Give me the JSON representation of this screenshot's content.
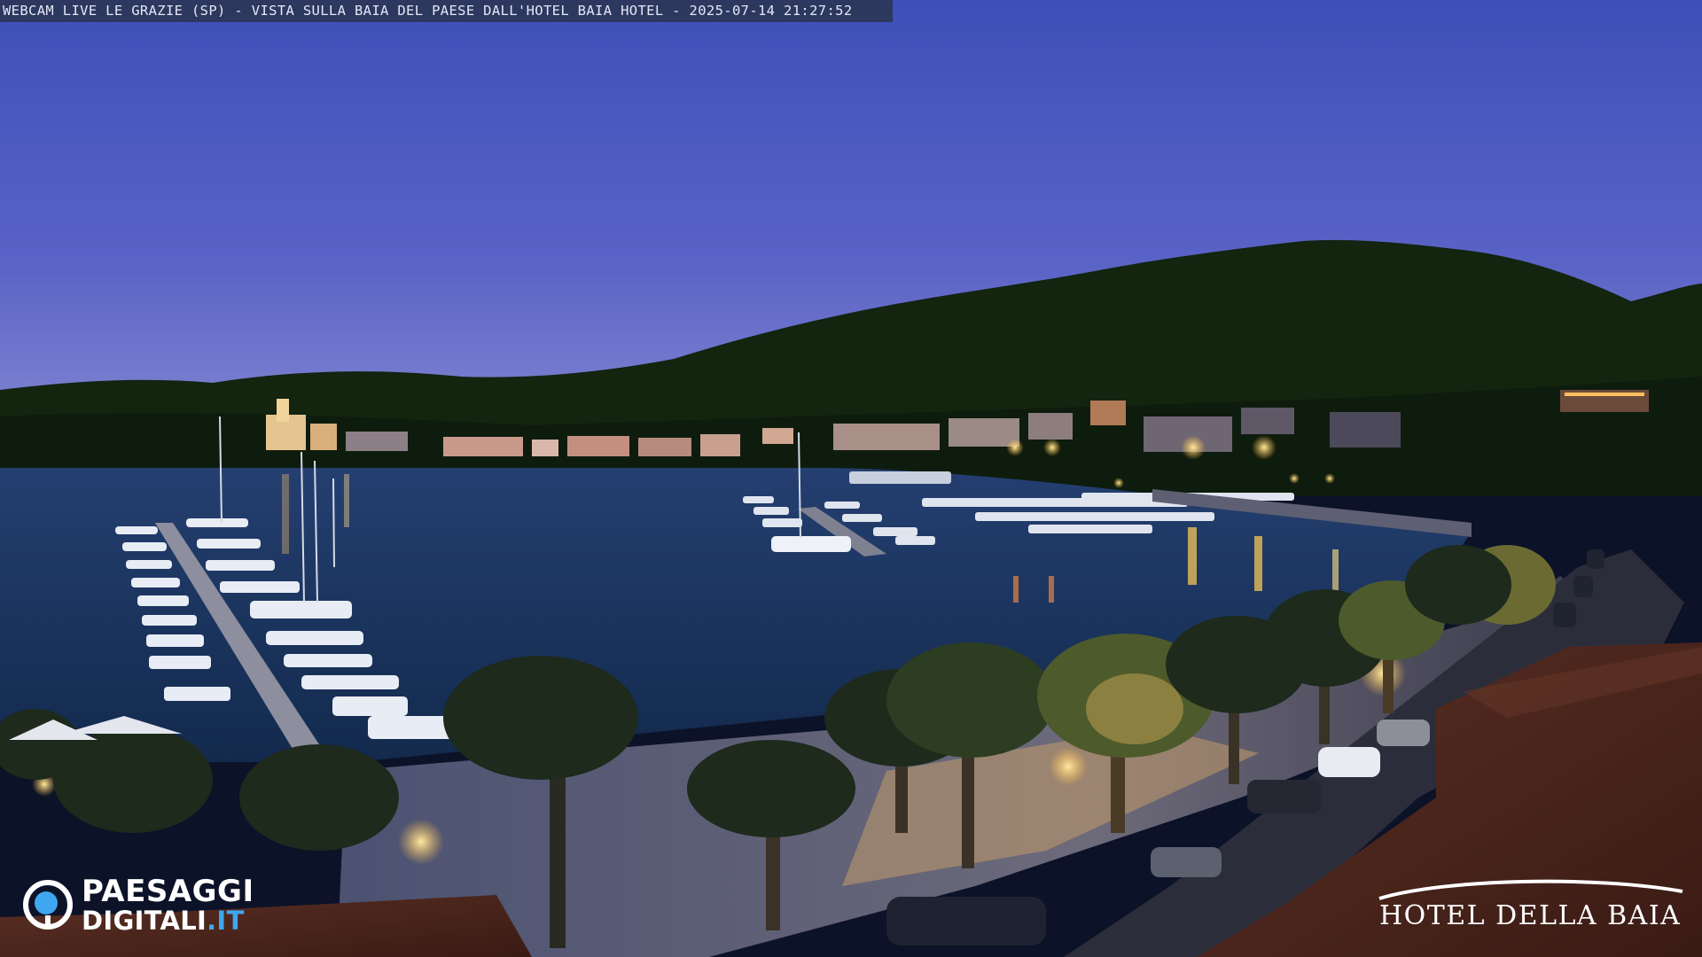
{
  "caption": "WEBCAM LIVE LE GRAZIE (SP) - VISTA SULLA BAIA DEL PAESE DALL'HOTEL BAIA HOTEL - 2025-07-14 21:27:52",
  "watermark_left": {
    "line1": "PAESAGGI",
    "line2_main": "DIGITALI",
    "line2_tld": ".IT",
    "icon": "eye-ring-icon",
    "tld_color": "#3ea7ef"
  },
  "watermark_right": {
    "name": "HOTEL DELLA BAIA",
    "icon": "arc-swoosh-icon"
  },
  "colors": {
    "sky_top": "#3f4fb8",
    "sky_horizon": "#8a8fd6",
    "water": "#1c3b66",
    "hills": "#10200f",
    "lights": "#ffc861"
  }
}
